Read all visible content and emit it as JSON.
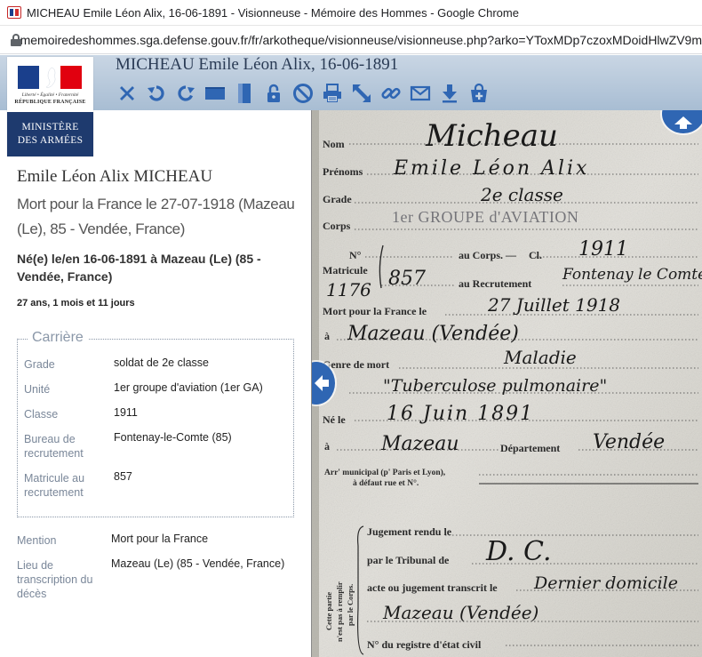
{
  "browser": {
    "window_title": "MICHEAU Emile Léon Alix, 16-06-1891 - Visionneuse - Mémoire des Hommes - Google Chrome",
    "url": "memoiredeshommes.sga.defense.gouv.fr/fr/arkotheque/visionneuse/visionneuse.php?arko=YToxMDp7czoxMDoidHlwZV9m"
  },
  "header": {
    "document_title": "MICHEAU Emile Léon Alix, 16-06-1891",
    "toolbar_icons": [
      "close-icon",
      "rotate-left-icon",
      "rotate-right-icon",
      "fit-width-icon",
      "fit-height-icon",
      "lock-icon",
      "no-entry-icon",
      "print-icon",
      "fullscreen-icon",
      "link-icon",
      "mail-icon",
      "download-icon",
      "add-to-cart-icon"
    ],
    "accent_color": "#2f66b3"
  },
  "logo": {
    "motto": "Liberté • Égalité • Fraternité",
    "republique": "RÉPUBLIQUE FRANÇAISE",
    "ministry_line1": "MINISTÈRE",
    "ministry_line2": "DES ARMÉES"
  },
  "person": {
    "name": "Emile Léon Alix MICHEAU",
    "death": "Mort pour la France le 27-07-1918 (Mazeau (Le), 85 - Vendée, France)",
    "birth": "Né(e) le/en 16-06-1891 à Mazeau (Le) (85 - Vendée, France)",
    "age": "27 ans, 1 mois et 11 jours"
  },
  "career": {
    "legend": "Carrière",
    "rows": [
      {
        "label": "Grade",
        "value": "soldat de 2e classe"
      },
      {
        "label": "Unité",
        "value": "1er groupe d'aviation (1er GA)"
      },
      {
        "label": "Classe",
        "value": "1911"
      },
      {
        "label": "Bureau de recrutement",
        "value": "Fontenay-le-Comte (85)"
      },
      {
        "label": "Matricule au recrutement",
        "value": "857"
      }
    ]
  },
  "extra": {
    "mention_label": "Mention",
    "mention_value": "Mort pour la France",
    "lieu_label": "Lieu de transcription du décès",
    "lieu_value": "Mazeau (Le) (85 - Vendée, France)"
  },
  "scan": {
    "labels": {
      "nom": "Nom",
      "prenoms": "Prénoms",
      "grade": "Grade",
      "corps": "Corps",
      "no": "N°",
      "au_corps": "au Corps. —",
      "cl": "Cl.",
      "matricule": "Matricule",
      "au_recrutement": "au Recrutement",
      "mort_pour": "Mort pour la France le",
      "a1": "à",
      "genre_de_mort": "Genre de mort",
      "ne_le": "Né le",
      "a2": "à",
      "departement": "Département",
      "arr_municipal": "Arr' municipal (p' Paris et Lyon),",
      "a_defaut": "à défaut rue et N°.",
      "jugement": "Jugement rendu le",
      "par_tribunal": "par le Tribunal de",
      "acte_ou": "acte ou jugement transcrit le",
      "no_registre": "N° du registre d'état civil",
      "side_note_1": "Cette partie",
      "side_note_2": "n'est pas à remplir",
      "side_note_3": "par le Corps."
    },
    "stamp": "1er GROUPE d'AVIATION",
    "handwritten": {
      "nom": "Micheau",
      "prenoms": "Emile Léon Alix",
      "grade": "2e classe",
      "classe": "1911",
      "numero": "1176",
      "matricule": "857",
      "recrutement": "Fontenay le Comte",
      "date_mort": "27 Juillet 1918",
      "lieu_mort": "Mazeau (Vendée)",
      "genre_mort_1": "Maladie",
      "genre_mort_2": "\"Tuberculose pulmonaire\"",
      "date_naissance": "16 Juin 1891",
      "lieu_naissance": "Mazeau",
      "departement": "Vendée",
      "tribunal": "D. C.",
      "transcrit": "Dernier domicile",
      "transcrit_lieu": "Mazeau (Vendée)"
    }
  }
}
